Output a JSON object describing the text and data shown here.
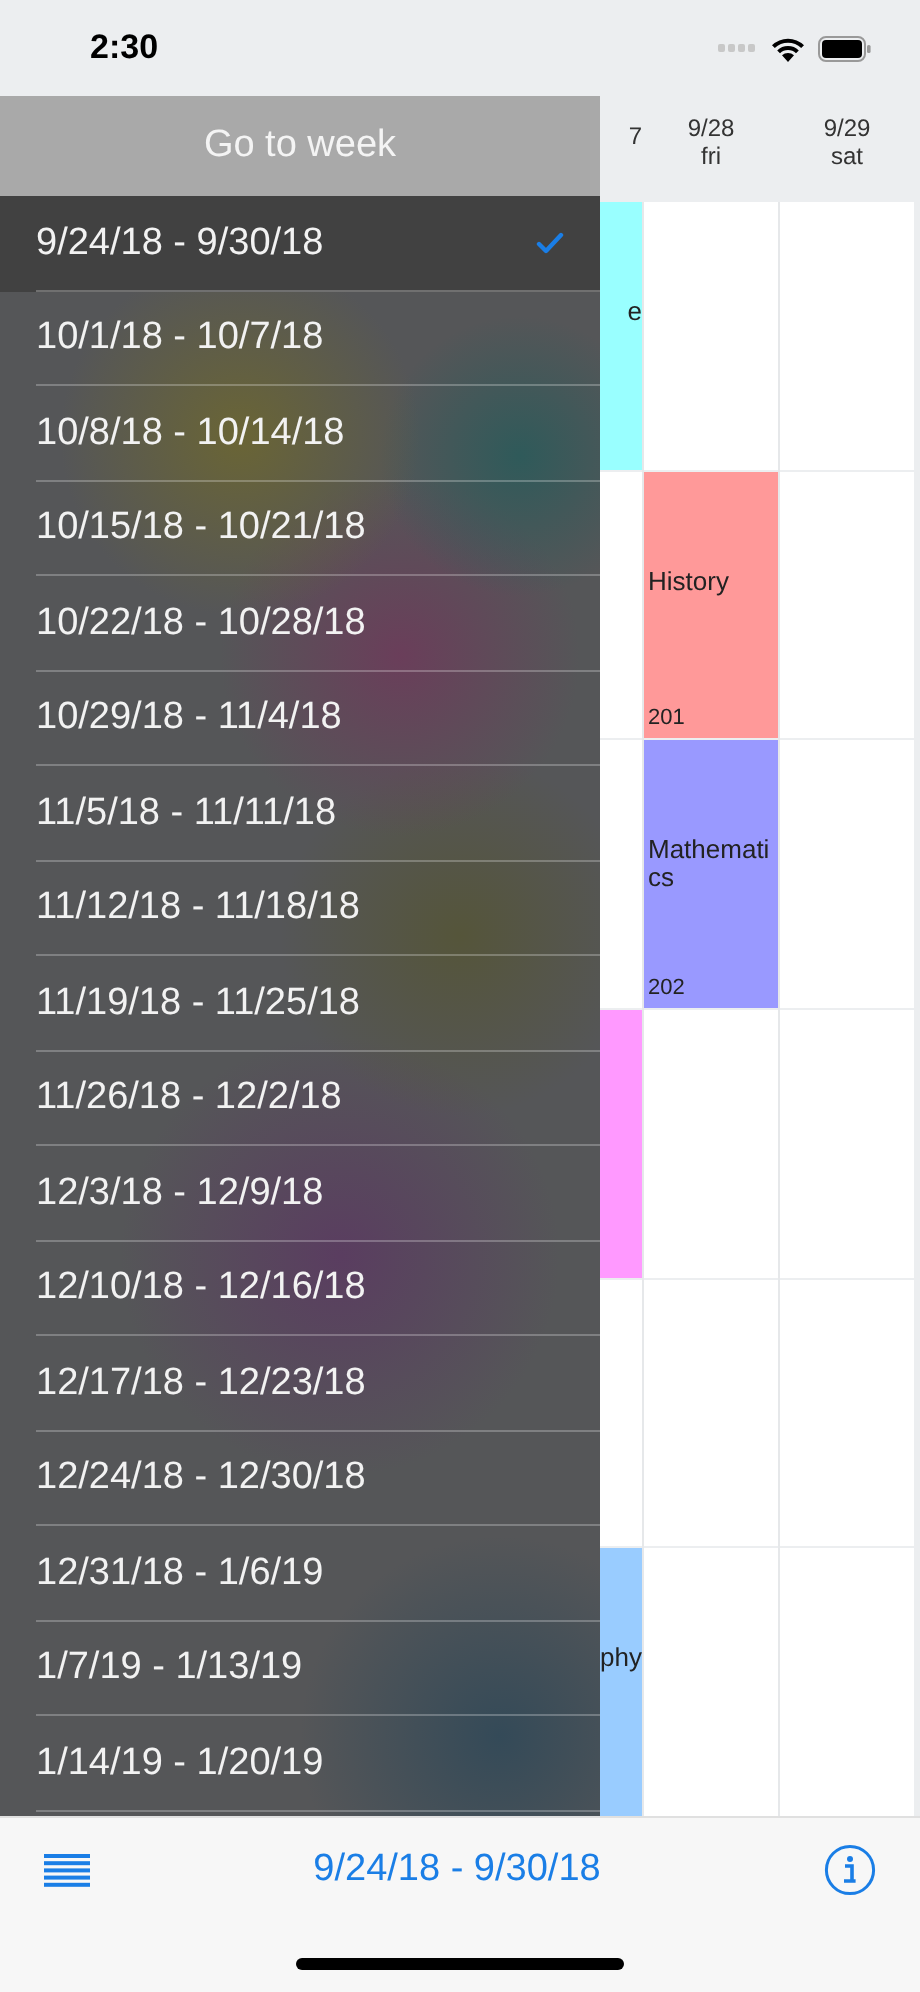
{
  "status_bar": {
    "time": "2:30"
  },
  "calendar": {
    "columns": [
      {
        "header": {
          "date": "7"
        },
        "cells": [
          {
            "kind": "class",
            "color": "#99ffff",
            "title": "e"
          },
          {
            "kind": "empty"
          },
          {
            "kind": "empty"
          },
          {
            "kind": "class",
            "color": "#ff99ff"
          },
          {
            "kind": "empty"
          },
          {
            "kind": "class",
            "color": "#99ccff",
            "title": "phy"
          }
        ]
      },
      {
        "header": {
          "date": "9/28",
          "day": "fri"
        },
        "cells": [
          {
            "kind": "empty"
          },
          {
            "kind": "class",
            "color": "#ff9999",
            "title": "History",
            "room": "201"
          },
          {
            "kind": "class",
            "color": "#9999ff",
            "title": "Mathematics",
            "room": "202"
          },
          {
            "kind": "empty"
          },
          {
            "kind": "empty"
          },
          {
            "kind": "empty"
          }
        ]
      },
      {
        "header": {
          "date": "9/29",
          "day": "sat"
        },
        "cells": [
          {
            "kind": "empty"
          },
          {
            "kind": "empty"
          },
          {
            "kind": "empty"
          },
          {
            "kind": "empty"
          },
          {
            "kind": "empty"
          },
          {
            "kind": "empty"
          }
        ]
      }
    ]
  },
  "week_menu": {
    "title": "Go to week",
    "items": [
      {
        "label": "9/24/18 - 9/30/18",
        "selected": true
      },
      {
        "label": "10/1/18 - 10/7/18",
        "selected": false
      },
      {
        "label": "10/8/18 - 10/14/18",
        "selected": false
      },
      {
        "label": "10/15/18 - 10/21/18",
        "selected": false
      },
      {
        "label": "10/22/18 - 10/28/18",
        "selected": false
      },
      {
        "label": "10/29/18 - 11/4/18",
        "selected": false
      },
      {
        "label": "11/5/18 - 11/11/18",
        "selected": false
      },
      {
        "label": "11/12/18 - 11/18/18",
        "selected": false
      },
      {
        "label": "11/19/18 - 11/25/18",
        "selected": false
      },
      {
        "label": "11/26/18 - 12/2/18",
        "selected": false
      },
      {
        "label": "12/3/18 - 12/9/18",
        "selected": false
      },
      {
        "label": "12/10/18 - 12/16/18",
        "selected": false
      },
      {
        "label": "12/17/18 - 12/23/18",
        "selected": false
      },
      {
        "label": "12/24/18 - 12/30/18",
        "selected": false
      },
      {
        "label": "12/31/18 - 1/6/19",
        "selected": false
      },
      {
        "label": "1/7/19 - 1/13/19",
        "selected": false
      },
      {
        "label": "1/14/19 - 1/20/19",
        "selected": false
      }
    ]
  },
  "toolbar": {
    "title": "9/24/18 - 9/30/18"
  }
}
